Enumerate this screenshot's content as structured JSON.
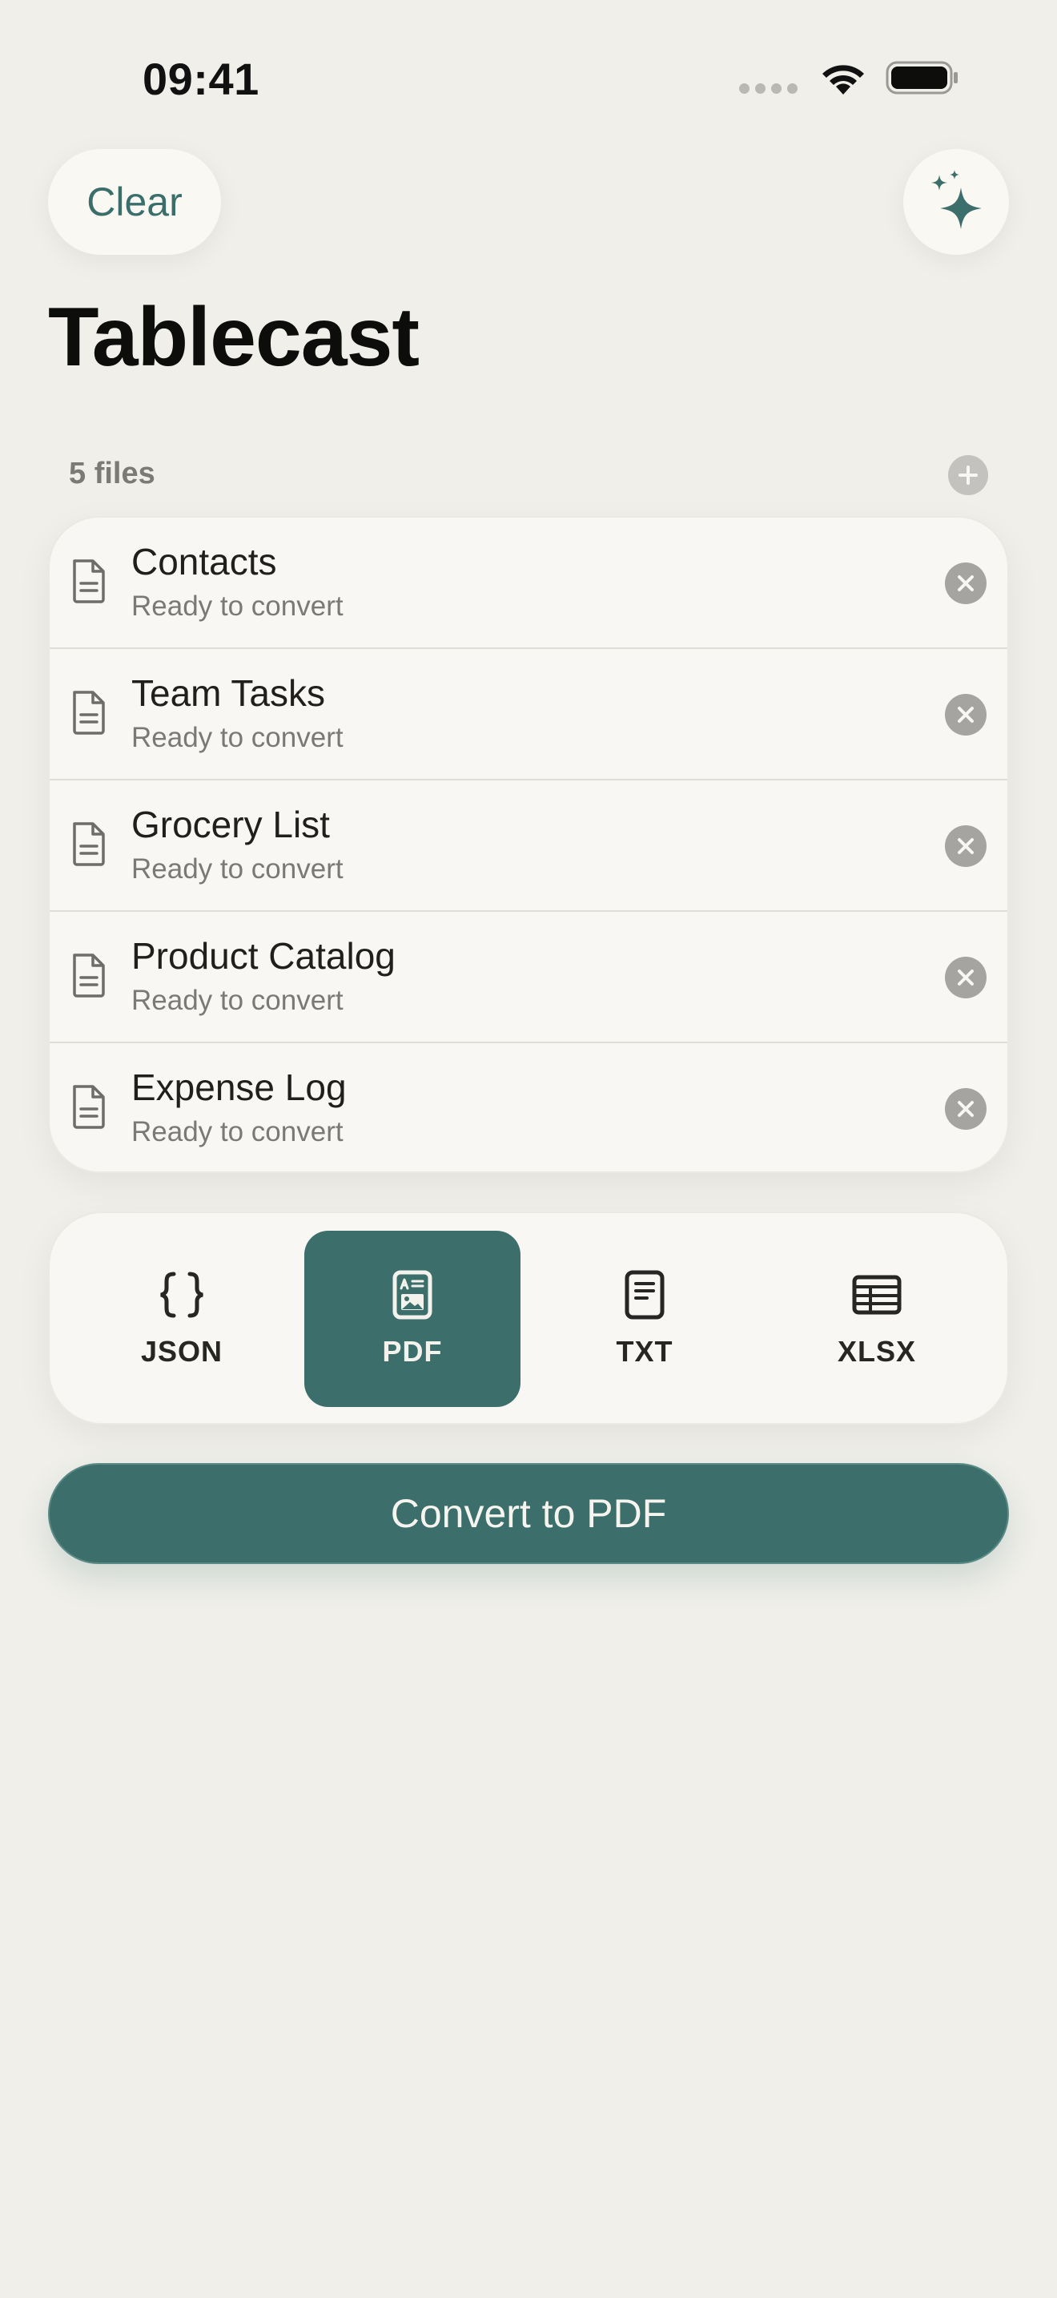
{
  "status_bar": {
    "time": "09:41"
  },
  "header": {
    "clear_label": "Clear",
    "title": "Tablecast"
  },
  "files": {
    "count_label": "5 files",
    "items": [
      {
        "name": "Contacts",
        "status": "Ready to convert"
      },
      {
        "name": "Team Tasks",
        "status": "Ready to convert"
      },
      {
        "name": "Grocery List",
        "status": "Ready to convert"
      },
      {
        "name": "Product Catalog",
        "status": "Ready to convert"
      },
      {
        "name": "Expense Log",
        "status": "Ready to convert"
      }
    ]
  },
  "formats": {
    "options": [
      {
        "label": "JSON",
        "icon": "braces-icon"
      },
      {
        "label": "PDF",
        "icon": "pdf-document-icon"
      },
      {
        "label": "TXT",
        "icon": "text-document-icon"
      },
      {
        "label": "XLSX",
        "icon": "table-grid-icon"
      }
    ],
    "selected": "PDF"
  },
  "convert": {
    "label": "Convert to PDF"
  },
  "colors": {
    "accent": "#3c6f6b",
    "background": "#f0efea",
    "card": "#f8f7f3",
    "muted_text": "#7a7975",
    "remove_badge": "#a5a4a0"
  }
}
